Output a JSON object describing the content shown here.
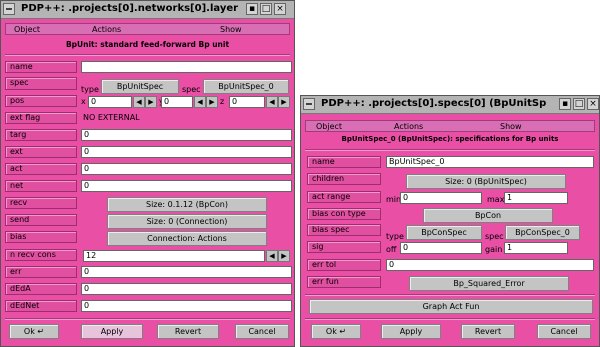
{
  "window1": {
    "title": "PDP++: .projects[0].networks[0].layer",
    "menu": [
      "Object",
      "Actions",
      "Show"
    ],
    "header": "BpUnit:  standard feed-forward Bp unit",
    "fields": {
      "name": {
        "label": "name",
        "value": ""
      },
      "spec": {
        "label": "spec",
        "type_label": "type",
        "type_btn": "BpUnitSpec",
        "spec_label": "spec",
        "spec_btn": "BpUnitSpec_0"
      },
      "pos": {
        "label": "pos",
        "x_label": "x",
        "x": "0",
        "y_label": "y",
        "y": "0",
        "z_label": "z",
        "z": "0"
      },
      "ext_flag": {
        "label": "ext flag",
        "value": "NO EXTERNAL"
      },
      "targ": {
        "label": "targ",
        "value": "0"
      },
      "ext": {
        "label": "ext",
        "value": "0"
      },
      "act": {
        "label": "act",
        "value": "0"
      },
      "net": {
        "label": "net",
        "value": "0"
      },
      "recv": {
        "label": "recv",
        "button": "Size: 0.1.12 (BpCon)"
      },
      "send": {
        "label": "send",
        "button": "Size: 0 (Connection)"
      },
      "bias": {
        "label": "bias",
        "button": "Connection: Actions"
      },
      "n_recv_cons": {
        "label": "n recv cons",
        "value": "12"
      },
      "err": {
        "label": "err",
        "value": "0"
      },
      "dEdA": {
        "label": "dEdA",
        "value": "0"
      },
      "dEdNet": {
        "label": "dEdNet",
        "value": "0"
      }
    },
    "buttons": {
      "ok": "Ok ↵",
      "apply": "Apply",
      "revert": "Revert",
      "cancel": "Cancel"
    }
  },
  "window2": {
    "title": "PDP++: .projects[0].specs[0] (BpUnitSp",
    "menu": [
      "Object",
      "Actions",
      "Show"
    ],
    "header": "BpUnitSpec_0 (BpUnitSpec):  specifications for Bp units",
    "fields": {
      "name": {
        "label": "name",
        "value": "BpUnitSpec_0"
      },
      "children": {
        "label": "children",
        "button": "Size: 0 (BpUnitSpec)"
      },
      "act_range": {
        "label": "act range",
        "min_label": "min",
        "min": "0",
        "max_label": "max",
        "max": "1"
      },
      "bias_con_type": {
        "label": "bias con type",
        "button": "BpCon"
      },
      "bias_spec": {
        "label": "bias spec",
        "type_label": "type",
        "type_btn": "BpConSpec",
        "spec_label": "spec",
        "spec_btn": "BpConSpec_0"
      },
      "sig": {
        "label": "sig",
        "off_label": "off",
        "off": "0",
        "gain_label": "gain",
        "gain": "1"
      },
      "err_tol": {
        "label": "err tol",
        "value": "0"
      },
      "err_fun": {
        "label": "err fun",
        "button": "Bp_Squared_Error"
      }
    },
    "graph_button": "Graph Act Fun",
    "buttons": {
      "ok": "Ok ↵",
      "apply": "Apply",
      "revert": "Revert",
      "cancel": "Cancel"
    }
  },
  "colors": {
    "window_bg": "#e84fa5",
    "titlebar": "#b4b4b4",
    "button": "#c4c4c4"
  }
}
